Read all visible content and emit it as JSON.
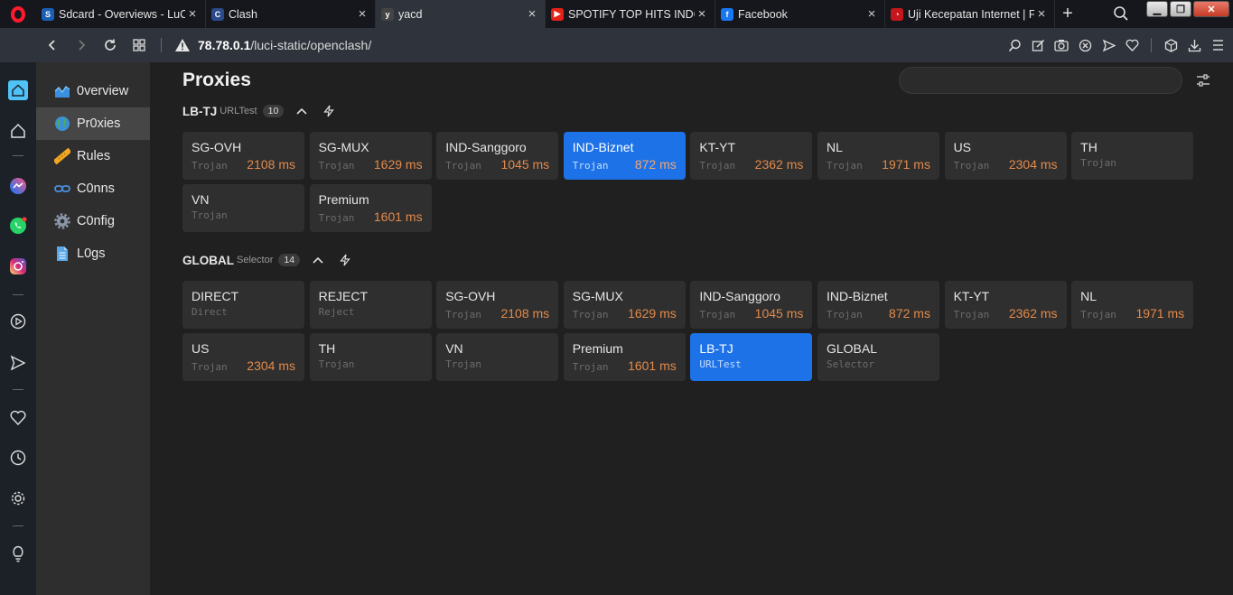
{
  "browser": {
    "tabs": [
      {
        "title": "Sdcard - Overviews - LuCI",
        "favicon_color": "#1a5fb4",
        "favicon_letter": "S",
        "active": false
      },
      {
        "title": "Clash",
        "favicon_color": "#2b4a8a",
        "favicon_letter": "C",
        "active": false
      },
      {
        "title": "yacd",
        "favicon_color": "#444444",
        "favicon_letter": "y",
        "active": true
      },
      {
        "title": "SPOTIFY TOP HITS INDONESIA",
        "favicon_color": "#e62117",
        "favicon_letter": "▶",
        "active": false
      },
      {
        "title": "Facebook",
        "favicon_color": "#1877f2",
        "favicon_letter": "f",
        "active": false
      },
      {
        "title": "Uji Kecepatan Internet | F",
        "favicon_color": "#c4161c",
        "favicon_letter": "◔",
        "active": false
      }
    ],
    "new_tab_label": "+",
    "url_host": "78.78.0.1",
    "url_path": "/luci-static/openclash/"
  },
  "nav": {
    "items": [
      {
        "label": "0verview",
        "icon": "overview-icon",
        "active": false
      },
      {
        "label": "Pr0xies",
        "icon": "globe-icon",
        "active": true
      },
      {
        "label": "Rules",
        "icon": "ruler-icon",
        "active": false
      },
      {
        "label": "C0nns",
        "icon": "link-icon",
        "active": false
      },
      {
        "label": "C0nfig",
        "icon": "gear-icon",
        "active": false
      },
      {
        "label": "L0gs",
        "icon": "document-icon",
        "active": false
      }
    ]
  },
  "page": {
    "title": "Proxies",
    "search_placeholder": ""
  },
  "groups": [
    {
      "name": "LB-TJ",
      "type": "URLTest",
      "count": "10",
      "proxies": [
        {
          "name": "SG-OVH",
          "type": "Trojan",
          "latency": "2108 ms",
          "selected": false
        },
        {
          "name": "SG-MUX",
          "type": "Trojan",
          "latency": "1629 ms",
          "selected": false
        },
        {
          "name": "IND-Sanggoro",
          "type": "Trojan",
          "latency": "1045 ms",
          "selected": false
        },
        {
          "name": "IND-Biznet",
          "type": "Trojan",
          "latency": "872 ms",
          "selected": true
        },
        {
          "name": "KT-YT",
          "type": "Trojan",
          "latency": "2362 ms",
          "selected": false
        },
        {
          "name": "NL",
          "type": "Trojan",
          "latency": "1971 ms",
          "selected": false
        },
        {
          "name": "US",
          "type": "Trojan",
          "latency": "2304 ms",
          "selected": false
        },
        {
          "name": "TH",
          "type": "Trojan",
          "latency": "",
          "selected": false
        },
        {
          "name": "VN",
          "type": "Trojan",
          "latency": "",
          "selected": false
        },
        {
          "name": "Premium",
          "type": "Trojan",
          "latency": "1601 ms",
          "selected": false
        }
      ]
    },
    {
      "name": "GLOBAL",
      "type": "Selector",
      "count": "14",
      "proxies": [
        {
          "name": "DIRECT",
          "type": "Direct",
          "latency": "",
          "selected": false
        },
        {
          "name": "REJECT",
          "type": "Reject",
          "latency": "",
          "selected": false
        },
        {
          "name": "SG-OVH",
          "type": "Trojan",
          "latency": "2108 ms",
          "selected": false
        },
        {
          "name": "SG-MUX",
          "type": "Trojan",
          "latency": "1629 ms",
          "selected": false
        },
        {
          "name": "IND-Sanggoro",
          "type": "Trojan",
          "latency": "1045 ms",
          "selected": false
        },
        {
          "name": "IND-Biznet",
          "type": "Trojan",
          "latency": "872 ms",
          "selected": false
        },
        {
          "name": "KT-YT",
          "type": "Trojan",
          "latency": "2362 ms",
          "selected": false
        },
        {
          "name": "NL",
          "type": "Trojan",
          "latency": "1971 ms",
          "selected": false
        },
        {
          "name": "US",
          "type": "Trojan",
          "latency": "2304 ms",
          "selected": false
        },
        {
          "name": "TH",
          "type": "Trojan",
          "latency": "",
          "selected": false
        },
        {
          "name": "VN",
          "type": "Trojan",
          "latency": "",
          "selected": false
        },
        {
          "name": "Premium",
          "type": "Trojan",
          "latency": "1601 ms",
          "selected": false
        },
        {
          "name": "LB-TJ",
          "type": "URLTest",
          "latency": "",
          "selected": true
        },
        {
          "name": "GLOBAL",
          "type": "Selector",
          "latency": "",
          "selected": false
        }
      ]
    }
  ],
  "colors": {
    "selected": "#1d72e8",
    "latency": "#e3894a",
    "card": "#2f2f2f",
    "background": "#202020"
  }
}
